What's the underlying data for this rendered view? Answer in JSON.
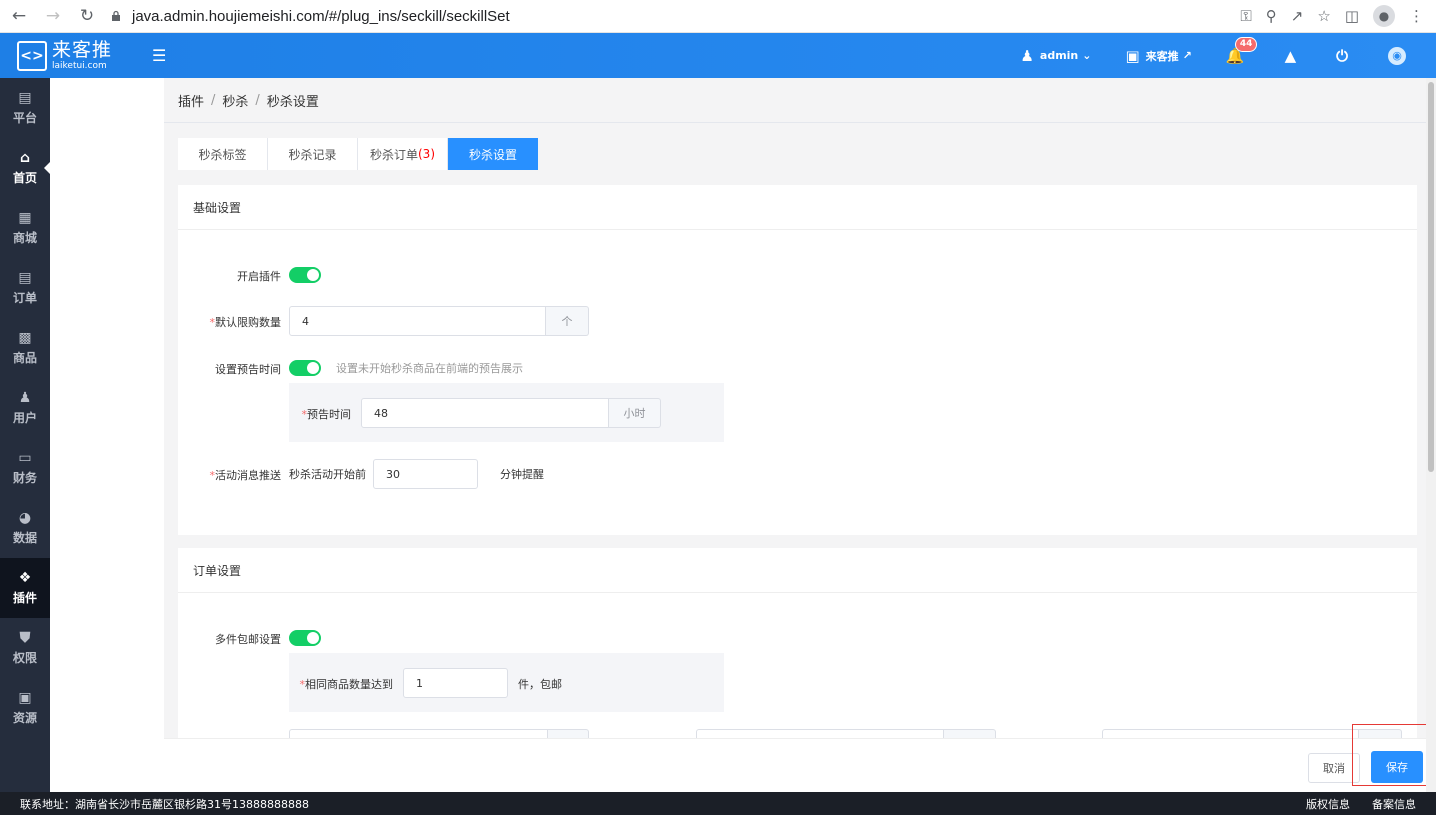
{
  "browser": {
    "url": "java.admin.houjiemeishi.com/#/plug_ins/seckill/seckillSet"
  },
  "header": {
    "logo_cn": "来客推",
    "logo_en": "laiketui.com",
    "user": "admin",
    "store": "来客推",
    "notifications": "44"
  },
  "sidebar": {
    "items": [
      {
        "label": "平台"
      },
      {
        "label": "首页"
      },
      {
        "label": "商城"
      },
      {
        "label": "订单"
      },
      {
        "label": "商品"
      },
      {
        "label": "用户"
      },
      {
        "label": "财务"
      },
      {
        "label": "数据"
      },
      {
        "label": "插件"
      },
      {
        "label": "权限"
      },
      {
        "label": "资源"
      }
    ]
  },
  "breadcrumb": {
    "a": "插件",
    "b": "秒杀",
    "c": "秒杀设置",
    "sep": "/"
  },
  "tabs": {
    "t1": "秒杀标签",
    "t2": "秒杀记录",
    "t3": "秒杀订单",
    "t3_count": "(3)",
    "t4": "秒杀设置"
  },
  "basic": {
    "title": "基础设置",
    "enable_label": "开启插件",
    "limit_label": "默认限购数量",
    "limit_value": "4",
    "limit_unit": "个",
    "preview_label": "设置预告时间",
    "preview_hint": "设置未开始秒杀商品在前端的预告展示",
    "preview_time_label": "预告时间",
    "preview_time_value": "48",
    "preview_time_unit": "小时",
    "push_label": "活动消息推送",
    "push_prefix": "秒杀活动开始前",
    "push_value": "30",
    "push_suffix": "分钟提醒",
    "required_mark": "*"
  },
  "order": {
    "title": "订单设置",
    "multi_label": "多件包邮设置",
    "same_label": "相同商品数量达到",
    "same_value": "1",
    "same_suffix": "件，包邮"
  },
  "actions": {
    "cancel": "取消",
    "save": "保存"
  },
  "footer": {
    "address": "联系地址：湖南省长沙市岳麓区银杉路31号13888888888",
    "copyright": "版权信息",
    "record": "备案信息"
  }
}
